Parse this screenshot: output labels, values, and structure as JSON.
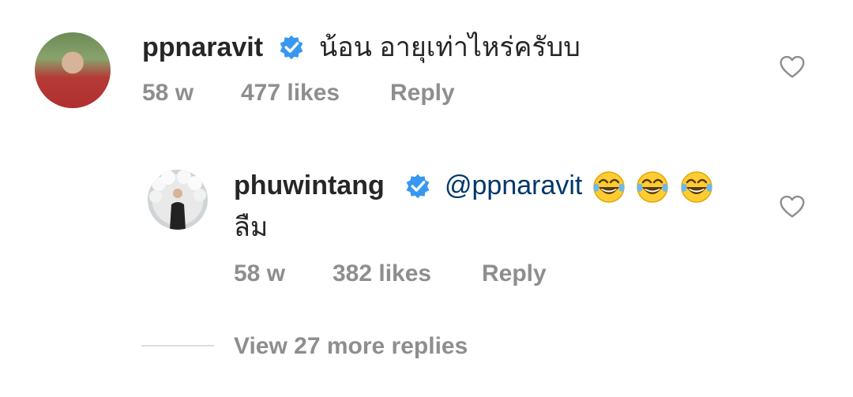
{
  "comments": [
    {
      "username": "ppnaravit",
      "text": "น้อน อายุเท่าไหร่ครับบ",
      "time": "58 w",
      "likes": "477 likes",
      "reply": "Reply"
    },
    {
      "username": "phuwintang",
      "mention": "@ppnaravit",
      "emojis": [
        "😂",
        "😂",
        "😂"
      ],
      "text": "ลืม",
      "time": "58 w",
      "likes": "382 likes",
      "reply": "Reply"
    }
  ],
  "view_more": "View 27 more replies",
  "colors": {
    "text": "#262626",
    "secondary": "#8e8e8e",
    "mention": "#00376b",
    "verified": "#3897f0",
    "divider": "#dbdbdb"
  },
  "icons": {
    "verified": "verified-badge-icon",
    "like": "heart-icon",
    "emoji": "face-with-tears-of-joy-emoji"
  }
}
